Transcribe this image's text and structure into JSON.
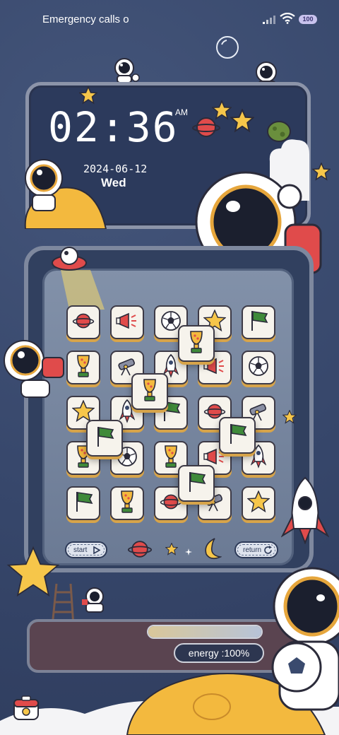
{
  "status_bar": {
    "text": "Emergency calls o",
    "battery": "100"
  },
  "clock": {
    "time": "02:36",
    "ampm": "AM",
    "date": "2024-06-12",
    "weekday": "Wed"
  },
  "board": {
    "grid": [
      [
        "planet",
        "megaphone",
        "soccer-ball",
        "star",
        "flag"
      ],
      [
        "trophy",
        "telescope",
        "rocket",
        "megaphone",
        "soccer-ball"
      ],
      [
        "star",
        "rocket",
        "flag",
        "planet",
        "telescope"
      ],
      [
        "trophy",
        "soccer-ball",
        "trophy",
        "megaphone",
        "rocket"
      ],
      [
        "flag",
        "trophy",
        "planet",
        "telescope",
        "star"
      ]
    ],
    "raised_tiles": [
      "trophy",
      "trophy",
      "flag",
      "flag",
      "flag"
    ]
  },
  "controls": {
    "start_label": "start",
    "return_label": "return"
  },
  "energy": {
    "label": "energy :100%",
    "level": 1.0
  },
  "colors": {
    "background": "#3a4a6e",
    "tile_face": "#f6f3ec",
    "tile_edge": "#d7a44a",
    "accent_red": "#e04b4b",
    "star_yellow": "#f6c64a"
  }
}
